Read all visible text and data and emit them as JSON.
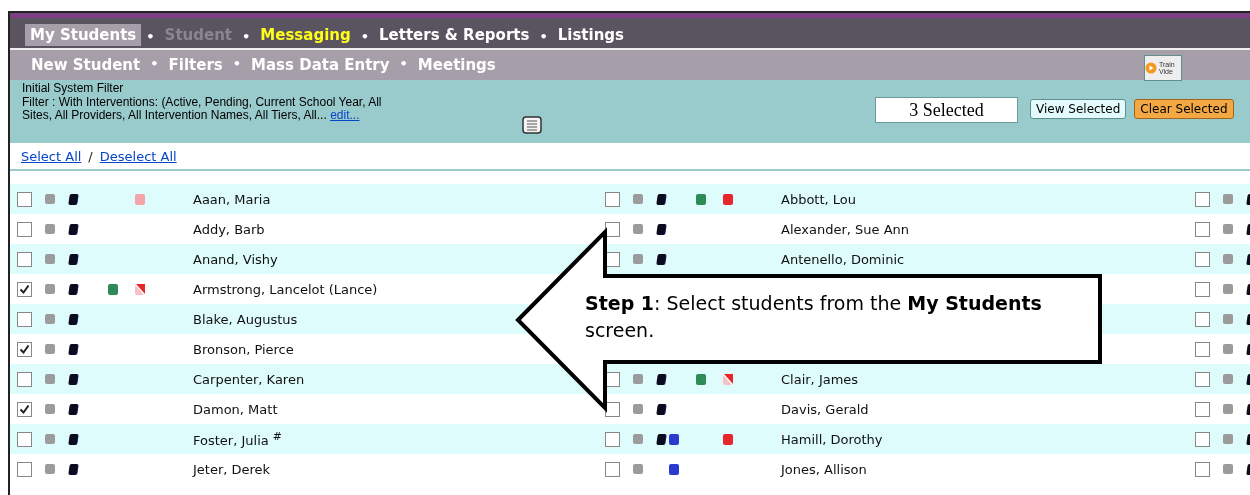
{
  "nav_primary": {
    "separator": "•",
    "items": [
      {
        "label": "My Students",
        "selected": true,
        "kind": "normal"
      },
      {
        "label": "Student",
        "selected": false,
        "kind": "disabled"
      },
      {
        "label": "Messaging",
        "selected": false,
        "kind": "highlight"
      },
      {
        "label": "Letters & Reports",
        "selected": false,
        "kind": "normal"
      },
      {
        "label": "Listings",
        "selected": false,
        "kind": "normal"
      }
    ]
  },
  "nav_secondary": {
    "separator": "•",
    "items": [
      {
        "label": "New Student"
      },
      {
        "label": "Filters"
      },
      {
        "label": "Mass Data Entry"
      },
      {
        "label": "Meetings"
      }
    ],
    "training_video": [
      "Train",
      "Vide"
    ]
  },
  "filter": {
    "lines": [
      "Initial System Filter",
      "Filter : With Interventions: (Active, Pending, Current School Year, All",
      "Sites, All Providers, All Intervention Names, All Tiers, All..."
    ],
    "edit_link": "edit...",
    "selected_count": "3 Selected",
    "buttons": [
      {
        "label": "View Selected",
        "kind": "secondary"
      },
      {
        "label": "Clear Selected",
        "kind": "primary"
      }
    ]
  },
  "selection_links": {
    "select_all": "Select All",
    "divider": "/",
    "deselect_all": "Deselect All"
  },
  "rows": [
    {
      "left": {
        "name": "Aaan, Maria",
        "checked": false,
        "dark_marker": true,
        "flags": {
          "status": {
            "color": "#f5a3a8",
            "kind": "solid"
          }
        }
      },
      "middle": {
        "name": "Abbott, Lou",
        "checked": false,
        "dark_marker": true,
        "flags": {
          "plan": {
            "color": "#2e8b57",
            "kind": "solid"
          },
          "status": {
            "color": "#e8262b",
            "kind": "solid"
          }
        }
      },
      "right": {
        "checked": false,
        "dark_marker": true
      }
    },
    {
      "left": {
        "name": "Addy, Barb",
        "checked": false,
        "dark_marker": true
      },
      "middle": {
        "name": "Alexander, Sue Ann",
        "checked": false,
        "dark_marker": true
      },
      "right": {
        "checked": false,
        "dark_marker": true
      }
    },
    {
      "left": {
        "name": "Anand, Vishy",
        "checked": false,
        "dark_marker": true
      },
      "middle": {
        "name": "Antenello, Dominic",
        "checked": false,
        "dark_marker": true
      },
      "right": {
        "checked": false,
        "dark_marker": true
      }
    },
    {
      "left": {
        "name": "Armstrong, Lancelot (Lance)",
        "checked": true,
        "dark_marker": true,
        "flags": {
          "plan": {
            "color": "#2e8b57",
            "kind": "solid"
          },
          "status": {
            "color": "#e8262b",
            "kind": "struck"
          }
        }
      },
      "right": {
        "checked": false,
        "dark_marker": true
      }
    },
    {
      "left": {
        "name": "Blake, Augustus",
        "checked": false,
        "dark_marker": true
      },
      "right": {
        "checked": false,
        "dark_marker": true
      }
    },
    {
      "left": {
        "name": "Bronson, Pierce",
        "checked": true,
        "dark_marker": true
      },
      "right": {
        "checked": false,
        "dark_marker": true
      }
    },
    {
      "left": {
        "name": "Carpenter, Karen",
        "checked": false,
        "dark_marker": true
      },
      "middle": {
        "name": "Clair, James",
        "checked": false,
        "dark_marker": true,
        "flags": {
          "plan": {
            "color": "#2e8b57",
            "kind": "solid"
          },
          "status": {
            "color": "#e8262b",
            "kind": "struck"
          }
        }
      },
      "right": {
        "checked": false,
        "dark_marker": true
      }
    },
    {
      "left": {
        "name": "Damon, Matt",
        "checked": true,
        "dark_marker": true
      },
      "middle": {
        "name": "Davis, Gerald",
        "checked": false,
        "dark_marker": true
      },
      "right": {
        "checked": false,
        "dark_marker": true
      }
    },
    {
      "left": {
        "name": "Foster, Julia $^{#}$",
        "checked": false,
        "dark_marker": true
      },
      "middle": {
        "name": "Hamill, Dorothy",
        "checked": false,
        "dark_marker": true,
        "flags": {
          "intervention": {
            "color": "#2b3bd0",
            "kind": "solid"
          },
          "status": {
            "color": "#e8262b",
            "kind": "solid"
          }
        }
      },
      "right": {
        "checked": false,
        "dark_marker": true
      }
    },
    {
      "left": {
        "name": "Jeter, Derek",
        "checked": false,
        "dark_marker": true
      },
      "middle": {
        "name": "Jones, Allison",
        "checked": false,
        "dark_marker": false,
        "flags": {
          "intervention": {
            "color": "#2b3bd0",
            "kind": "solid"
          }
        }
      },
      "right": {
        "checked": false,
        "dark_marker": true
      }
    }
  ],
  "callout": {
    "text": "**Step 1**: Select students from the **My Students** screen."
  }
}
